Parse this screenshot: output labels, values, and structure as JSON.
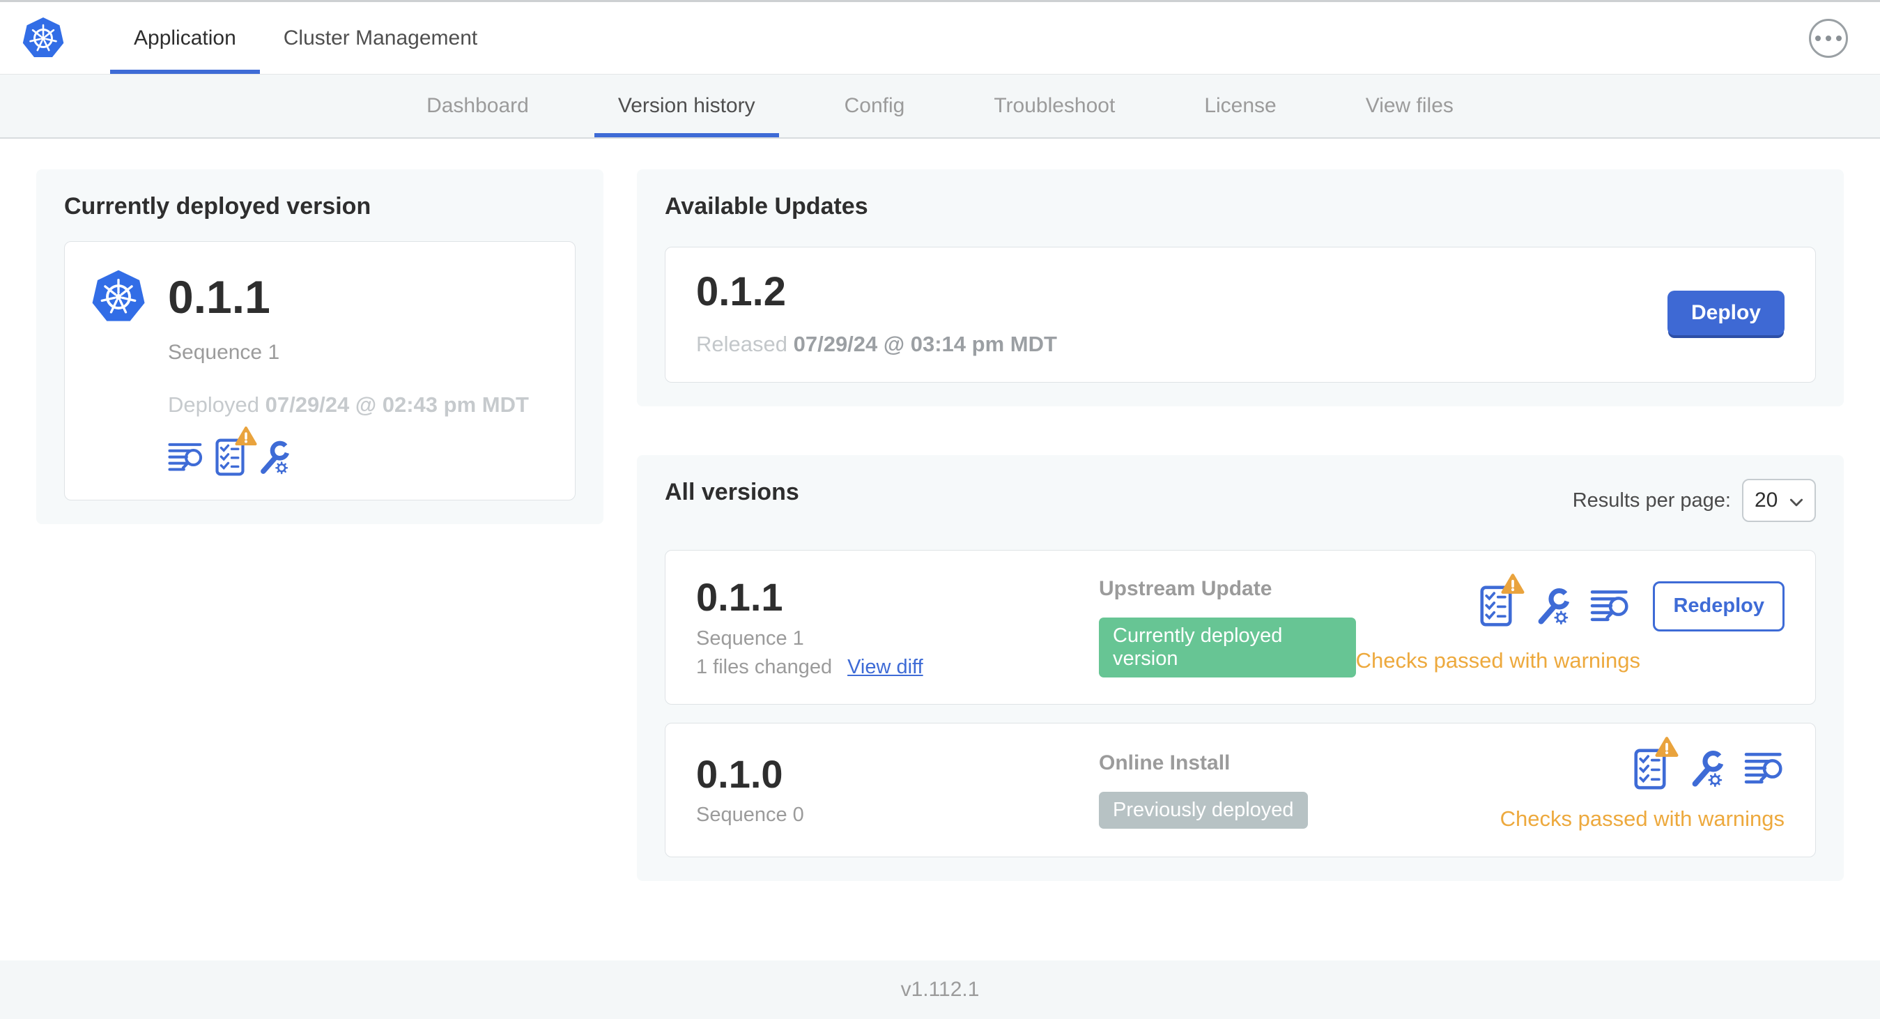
{
  "header": {
    "tabs": [
      {
        "label": "Application",
        "active": true
      },
      {
        "label": "Cluster Management",
        "active": false
      }
    ]
  },
  "subnav": {
    "tabs": [
      "Dashboard",
      "Version history",
      "Config",
      "Troubleshoot",
      "License",
      "View files"
    ],
    "active_tab": "Version history"
  },
  "current_version_card": {
    "title": "Currently deployed version",
    "version": "0.1.1",
    "sequence": "Sequence 1",
    "deployed_prefix": "Deployed",
    "deployed_date": "07/29/24 @ 02:43 pm MDT",
    "icons": [
      "release-notes-icon",
      "preflight-checks-warning-icon",
      "config-icon"
    ]
  },
  "available_updates": {
    "title": "Available Updates",
    "version": "0.1.2",
    "released_prefix": "Released",
    "released_date": "07/29/24 @ 03:14 pm MDT",
    "deploy_label": "Deploy"
  },
  "all_versions": {
    "title": "All versions",
    "results_per_page_label": "Results per page:",
    "results_per_page_value": "20",
    "rows": [
      {
        "version": "0.1.1",
        "sequence": "Sequence 1",
        "files_changed": "1 files changed",
        "view_diff_label": "View diff",
        "source": "Upstream Update",
        "badge": "Currently deployed version",
        "badge_type": "green",
        "status": "Checks passed with warnings",
        "action_label": "Redeploy",
        "icons": [
          "preflight-checks-warning-icon",
          "config-icon",
          "release-notes-icon"
        ]
      },
      {
        "version": "0.1.0",
        "sequence": "Sequence 0",
        "source": "Online Install",
        "badge": "Previously deployed",
        "badge_type": "gray",
        "status": "Checks passed with warnings",
        "icons": [
          "preflight-checks-warning-icon",
          "config-icon",
          "release-notes-icon"
        ]
      }
    ]
  },
  "footer": {
    "app_version": "v1.112.1"
  },
  "colors": {
    "accent_blue": "#3e6bd6",
    "kubernetes_blue": "#326de6",
    "success_green": "#67c594",
    "neutral_badge_gray": "#b7c2c4",
    "warning_amber": "#e9a33d"
  }
}
